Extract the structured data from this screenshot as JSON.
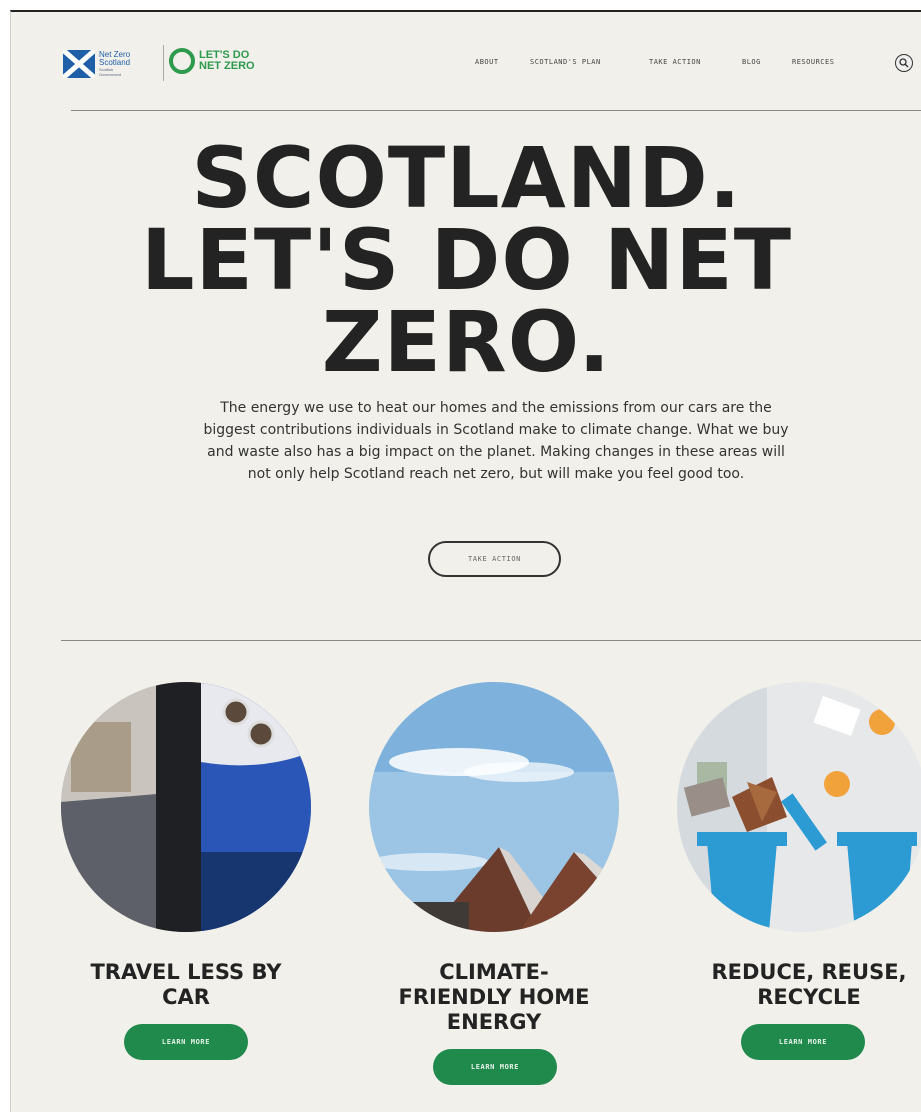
{
  "header": {
    "gov_logo": {
      "line1": "Net Zero",
      "line2": "Scotland",
      "line3": "Scottish",
      "line4": "Government"
    },
    "campaign_logo": {
      "line1": "LET'S DO",
      "line2": "NET ZERO"
    },
    "nav": {
      "about": "ABOUT",
      "plan": "SCOTLAND'S PLAN",
      "action": "TAKE ACTION",
      "blog": "BLOG",
      "resources": "RESOURCES"
    },
    "search_icon": "search-icon"
  },
  "hero": {
    "title_lines": [
      "SCOTLAND.",
      "LET'S DO NET",
      "ZERO."
    ],
    "body": "The energy we use to heat our homes and the emissions from our cars are the biggest contributions individuals in Scotland make to climate change. What we buy and waste also has a big impact on the planet. Making changes in these areas will not only help Scotland reach net zero, but will make you feel good too.",
    "cta": "TAKE ACTION"
  },
  "cards": [
    {
      "title_lines": [
        "TRAVEL LESS BY",
        "CAR"
      ],
      "button": "LEARN MORE"
    },
    {
      "title_lines": [
        "CLIMATE-",
        "FRIENDLY HOME",
        "ENERGY"
      ],
      "button": "LEARN MORE"
    },
    {
      "title_lines": [
        "REDUCE, REUSE,",
        "RECYCLE"
      ],
      "button": "LEARN MORE"
    }
  ],
  "colors": {
    "background": "#f1f0ea",
    "brand_green": "#1f8a4c",
    "logo_green": "#2e9a4e",
    "gov_blue": "#1f5fa8",
    "text_dark": "#232323"
  }
}
